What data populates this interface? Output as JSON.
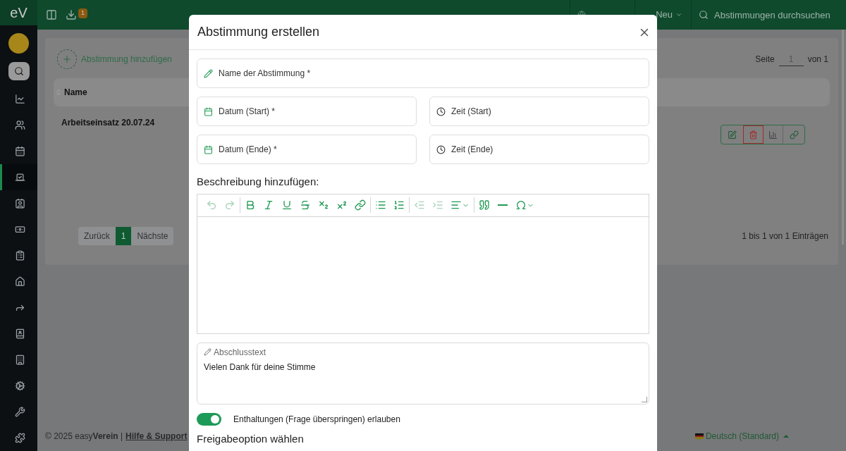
{
  "logo": "eV",
  "header": {
    "badge": "1",
    "new": "Neu",
    "search_placeholder": "Abstimmungen durchsuchen"
  },
  "sidebar": {
    "items": [
      {
        "selected": false
      },
      {
        "selected": false
      },
      {
        "selected": false
      },
      {
        "selected": true
      },
      {
        "selected": false
      },
      {
        "selected": false
      },
      {
        "selected": false
      },
      {
        "selected": false
      },
      {
        "selected": false
      },
      {
        "selected": false
      },
      {
        "selected": false
      },
      {
        "selected": false
      },
      {
        "selected": false
      },
      {
        "selected": false
      }
    ]
  },
  "page": {
    "add_label": "Abstimmung hinzufügen",
    "page_label": "Seite",
    "page_value": "1",
    "page_of": "von 1",
    "columns": [
      "Name"
    ],
    "rows": [
      {
        "name": "Arbeitseinsatz 20.07.24"
      }
    ],
    "pagination": [
      {
        "label": "Zurück",
        "selected": false
      },
      {
        "label": "1",
        "selected": true
      },
      {
        "label": "Nächste",
        "selected": false
      }
    ],
    "entries": "1 bis 1 von 1 Einträgen"
  },
  "footer": {
    "copyright": "© 2025 easy**Verein** |",
    "help_link": "Hilfe & Support",
    "language": "Deutsch (Standard)"
  },
  "modal": {
    "title": "Abstimmung erstellen",
    "name_field": {
      "placeholder": "Name der Abstimmung *"
    },
    "date_fields": [
      {
        "placeholder": "Datum (Start) *",
        "kind": "date"
      },
      {
        "placeholder": "Zeit (Start)",
        "kind": "time"
      },
      {
        "placeholder": "Datum (Ende) *",
        "kind": "date"
      },
      {
        "placeholder": "Zeit (Ende)",
        "kind": "time"
      }
    ],
    "description_label": "Beschreibung hinzufügen:",
    "toolbar": [
      [
        {
          "disabled": true
        },
        {
          "disabled": true
        }
      ],
      [
        {
          "disabled": false
        },
        {
          "disabled": false
        },
        {
          "disabled": false
        },
        {
          "disabled": false
        },
        {
          "disabled": false
        },
        {
          "disabled": false
        },
        {
          "disabled": false
        }
      ],
      [
        {
          "disabled": false
        },
        {
          "disabled": false
        }
      ],
      [
        {
          "disabled": true
        },
        {
          "disabled": true
        },
        {
          "disabled": false
        }
      ],
      [
        {
          "disabled": false
        },
        {
          "disabled": false
        },
        {
          "disabled": false
        }
      ]
    ],
    "closing_text": {
      "label": "Abschlusstext",
      "value": "Vielen Dank für deine Stimme"
    },
    "abstain_toggle": {
      "on": true,
      "label": "Enthaltungen (Frage überspringen) erlauben"
    },
    "release_heading": "Freigabeoption wählen"
  }
}
